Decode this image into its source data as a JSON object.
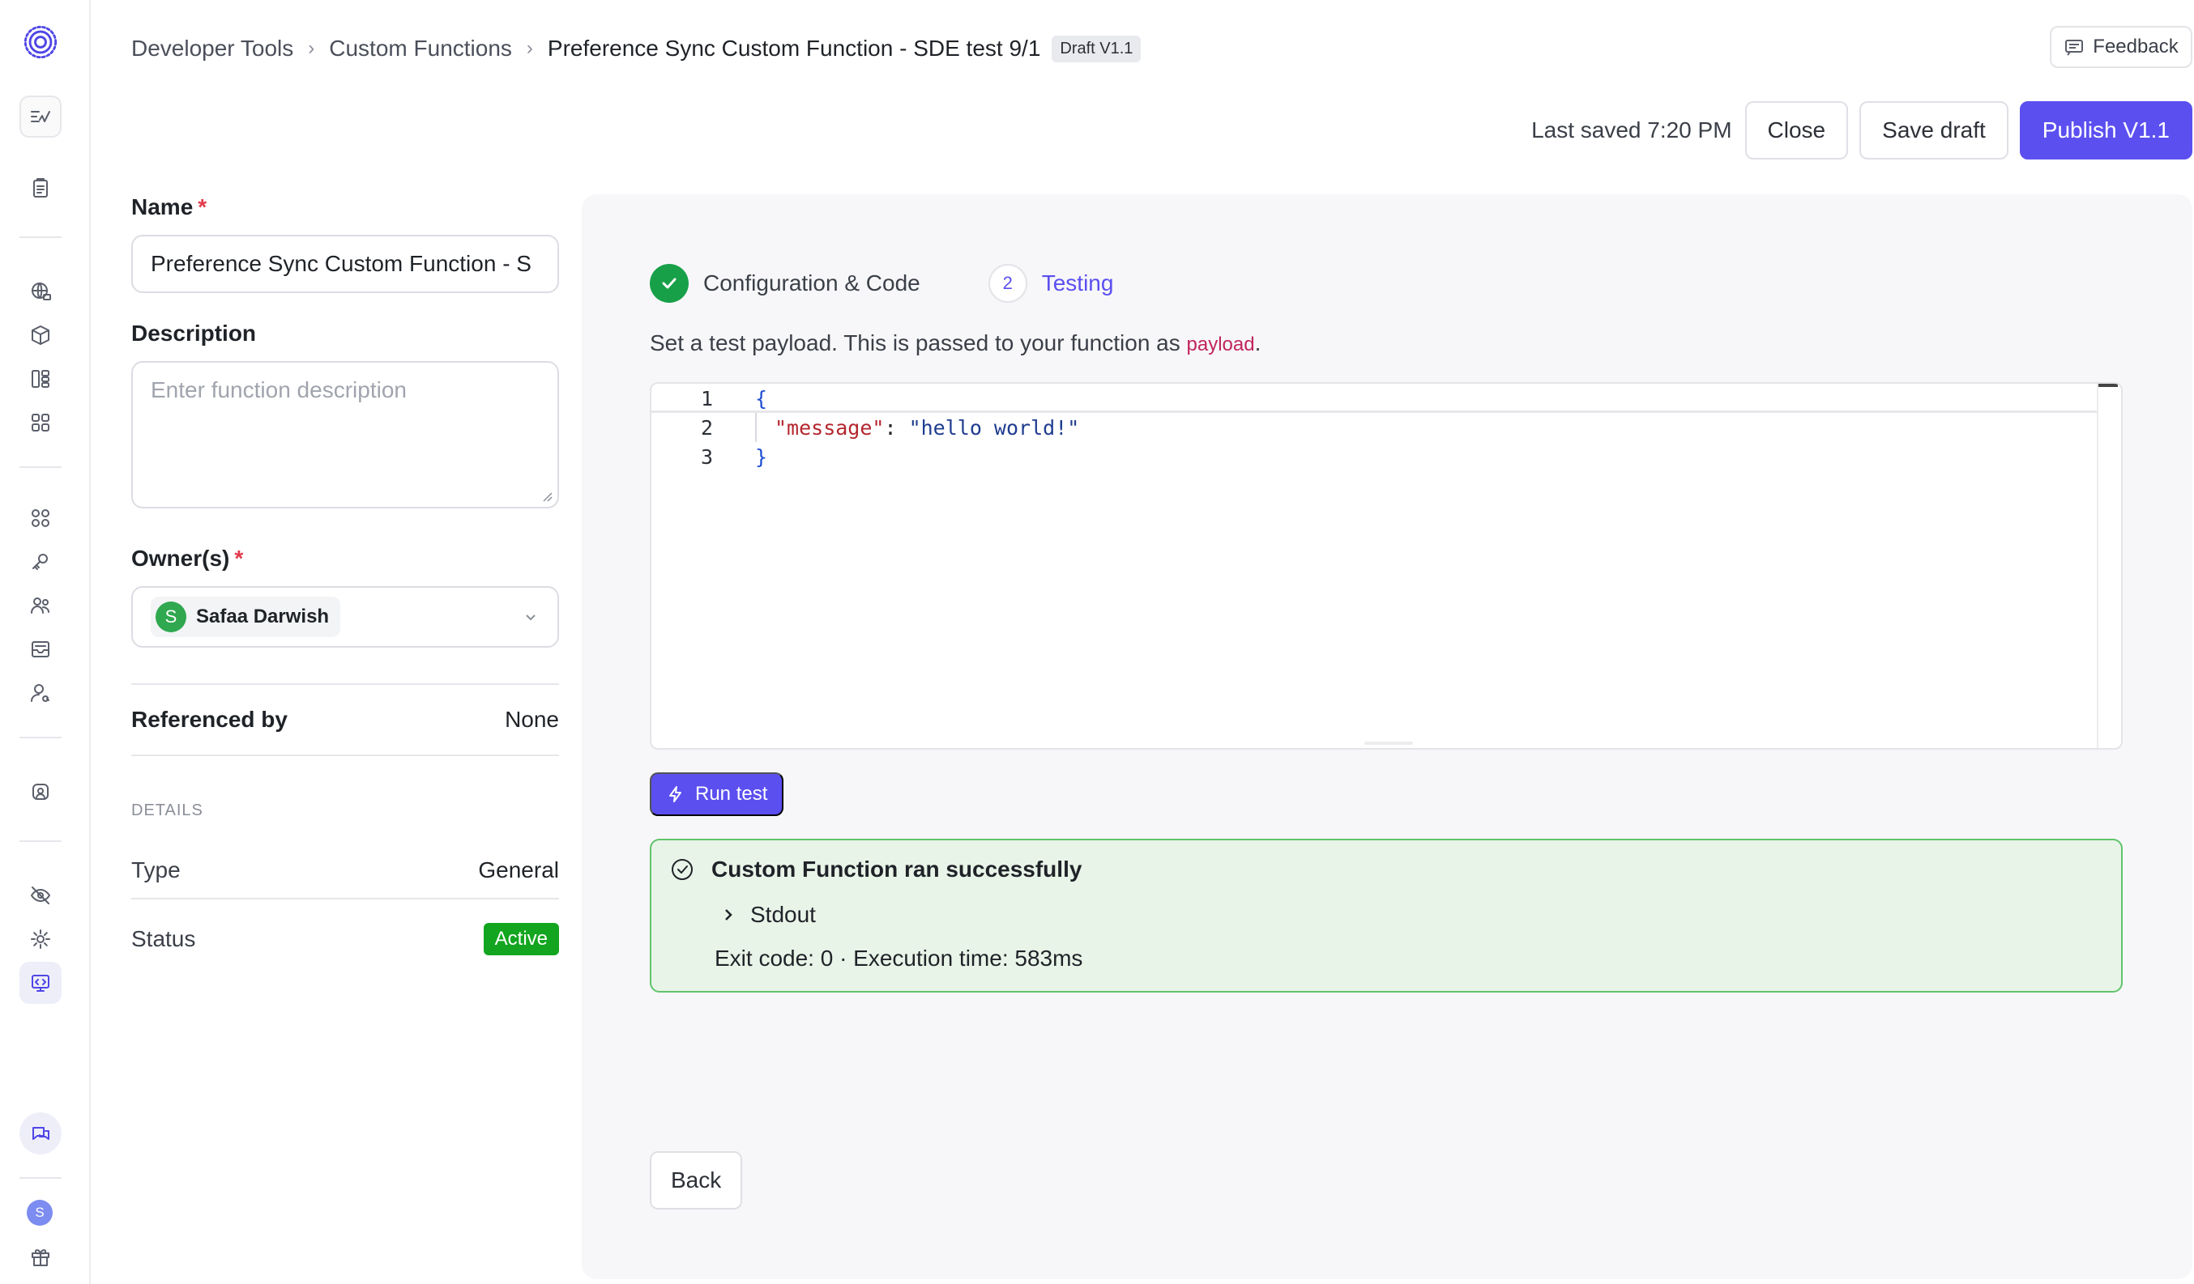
{
  "breadcrumb": {
    "items": [
      "Developer Tools",
      "Custom Functions"
    ],
    "current": "Preference Sync Custom Function - SDE test 9/1",
    "badge": "Draft V1.1"
  },
  "header": {
    "feedback_label": "Feedback",
    "last_saved": "Last saved 7:20 PM",
    "close_label": "Close",
    "save_draft_label": "Save draft",
    "publish_label": "Publish V1.1"
  },
  "form": {
    "name_label": "Name",
    "name_value": "Preference Sync Custom Function - S",
    "required_mark": "*",
    "description_label": "Description",
    "description_placeholder": "Enter function description",
    "owners_label": "Owner(s)",
    "owner": {
      "initial": "S",
      "name": "Safaa Darwish"
    },
    "referenced_by_label": "Referenced by",
    "referenced_by_value": "None",
    "details_title": "DETAILS",
    "type_label": "Type",
    "type_value": "General",
    "status_label": "Status",
    "status_value": "Active"
  },
  "steps": [
    {
      "number": "1",
      "label": "Configuration & Code",
      "state": "done"
    },
    {
      "number": "2",
      "label": "Testing",
      "state": "active"
    }
  ],
  "testing": {
    "help_text": "Set a test payload. This is passed to your function as ",
    "help_code": "payload",
    "help_end": ".",
    "editor_lines": [
      {
        "number": "1",
        "text": "{"
      },
      {
        "number": "2",
        "key": "\"message\"",
        "colon": ": ",
        "value": "\"hello world!\""
      },
      {
        "number": "3",
        "text": "}"
      }
    ],
    "run_label": "Run test",
    "result": {
      "title": "Custom Function ran successfully",
      "stdout_label": "Stdout",
      "exit_line": "Exit code: 0 · Execution time: 583ms"
    },
    "back_label": "Back"
  },
  "sidebar": {
    "user_initial": "S"
  },
  "colors": {
    "accent": "#5b4ff0",
    "success": "#18a049",
    "status_active": "#13a51f"
  }
}
